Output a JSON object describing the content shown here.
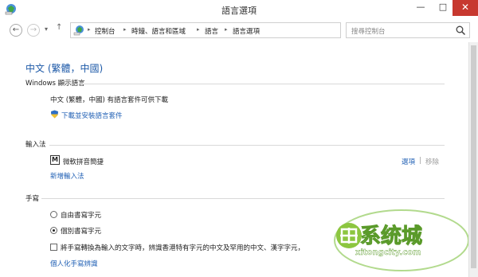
{
  "window": {
    "title": "語言選項",
    "min_glyph": "—",
    "max_glyph": "□",
    "close_glyph": "✕"
  },
  "nav": {
    "back_glyph": "←",
    "forward_glyph": "→",
    "dropdown_glyph": "▾",
    "up_glyph": "↑",
    "refresh_glyph": "↻",
    "breadcrumbs": [
      "控制台",
      "時鐘、語言和區域",
      "語言",
      "語言選項"
    ],
    "sep_glyph": "▸",
    "search_placeholder": "搜尋控制台"
  },
  "page": {
    "title": "中文 (繁體，中國)",
    "display_lang": {
      "heading": "Windows 顯示語言",
      "status": "中文 (繁體，中國) 有語言套件可供下載",
      "download_link": "下載並安裝語言套件"
    },
    "input": {
      "heading": "輸入法",
      "method_icon": "M",
      "method_name": "微軟拼音簡捷",
      "options_link": "選項",
      "divider": "|",
      "remove_link": "移除",
      "add_link": "新增輸入法"
    },
    "handwriting": {
      "heading": "手寫",
      "radio_free": "自由書寫字元",
      "radio_single": "個別書寫字元",
      "checkbox_text": "將手寫轉換為輸入的文字時，辨識香港特有字元的中文及罕用的中文、漢字字元，",
      "personalize_link": "個人化手寫辨識"
    }
  },
  "watermark": {
    "brand": "系统城",
    "domain": "xitongcity.com"
  }
}
